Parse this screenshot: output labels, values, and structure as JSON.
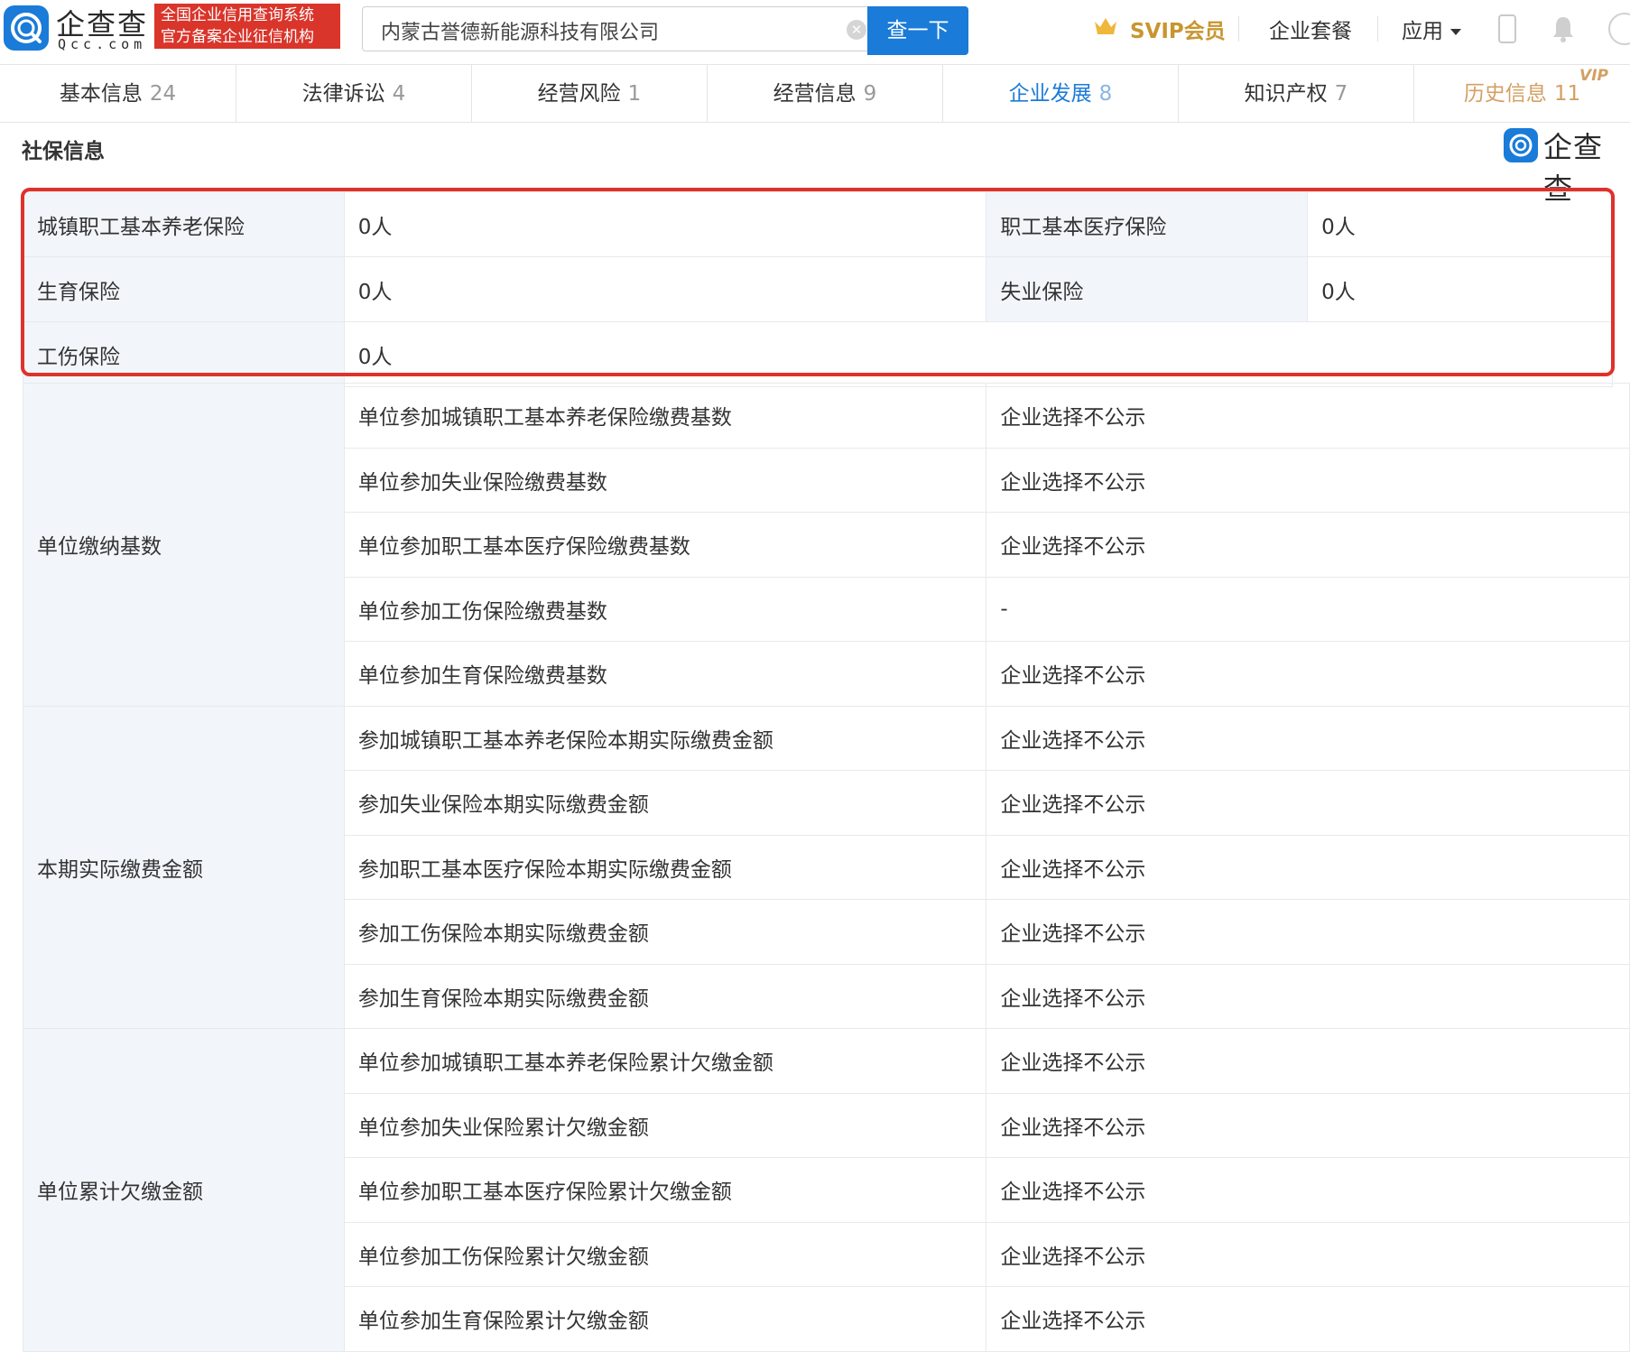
{
  "header": {
    "logo_text": "企查查",
    "logo_sub": "Qcc.com",
    "badge_line1": "全国企业信用查询系统",
    "badge_line2": "官方备案企业征信机构",
    "search_value": "内蒙古誉德新能源科技有限公司",
    "search_button": "查一下",
    "svip_label": "SVIP会员",
    "nav_packages": "企业套餐",
    "nav_apps": "应用"
  },
  "tabs": [
    {
      "label": "基本信息",
      "count": "24"
    },
    {
      "label": "法律诉讼",
      "count": "4"
    },
    {
      "label": "经营风险",
      "count": "1"
    },
    {
      "label": "经营信息",
      "count": "9"
    },
    {
      "label": "企业发展",
      "count": "8"
    },
    {
      "label": "知识产权",
      "count": "7"
    },
    {
      "label": "历史信息",
      "count": "11",
      "badge": "VIP"
    }
  ],
  "section": {
    "title": "社保信息",
    "brand": "企查查"
  },
  "insurance": {
    "pension_label": "城镇职工基本养老保险",
    "pension_value": "0人",
    "medical_label": "职工基本医疗保险",
    "medical_value": "0人",
    "maternity_label": "生育保险",
    "maternity_value": "0人",
    "unemployment_label": "失业保险",
    "unemployment_value": "0人",
    "injury_label": "工伤保险",
    "injury_value": "0人"
  },
  "groups": [
    {
      "label": "单位缴纳基数",
      "rows": [
        {
          "item": "单位参加城镇职工基本养老保险缴费基数",
          "value": "企业选择不公示"
        },
        {
          "item": "单位参加失业保险缴费基数",
          "value": "企业选择不公示"
        },
        {
          "item": "单位参加职工基本医疗保险缴费基数",
          "value": "企业选择不公示"
        },
        {
          "item": "单位参加工伤保险缴费基数",
          "value": "-"
        },
        {
          "item": "单位参加生育保险缴费基数",
          "value": "企业选择不公示"
        }
      ]
    },
    {
      "label": "本期实际缴费金额",
      "rows": [
        {
          "item": "参加城镇职工基本养老保险本期实际缴费金额",
          "value": "企业选择不公示"
        },
        {
          "item": "参加失业保险本期实际缴费金额",
          "value": "企业选择不公示"
        },
        {
          "item": "参加职工基本医疗保险本期实际缴费金额",
          "value": "企业选择不公示"
        },
        {
          "item": "参加工伤保险本期实际缴费金额",
          "value": "企业选择不公示"
        },
        {
          "item": "参加生育保险本期实际缴费金额",
          "value": "企业选择不公示"
        }
      ]
    },
    {
      "label": "单位累计欠缴金额",
      "rows": [
        {
          "item": "单位参加城镇职工基本养老保险累计欠缴金额",
          "value": "企业选择不公示"
        },
        {
          "item": "单位参加失业保险累计欠缴金额",
          "value": "企业选择不公示"
        },
        {
          "item": "单位参加职工基本医疗保险累计欠缴金额",
          "value": "企业选择不公示"
        },
        {
          "item": "单位参加工伤保险累计欠缴金额",
          "value": "企业选择不公示"
        },
        {
          "item": "单位参加生育保险累计欠缴金额",
          "value": "企业选择不公示"
        }
      ]
    }
  ],
  "colors": {
    "brand_blue": "#1a7bd8",
    "badge_red": "#d9352b",
    "highlight_red": "#e0312b",
    "svip_gold": "#c8962f",
    "label_bg": "#f2f6fb"
  }
}
